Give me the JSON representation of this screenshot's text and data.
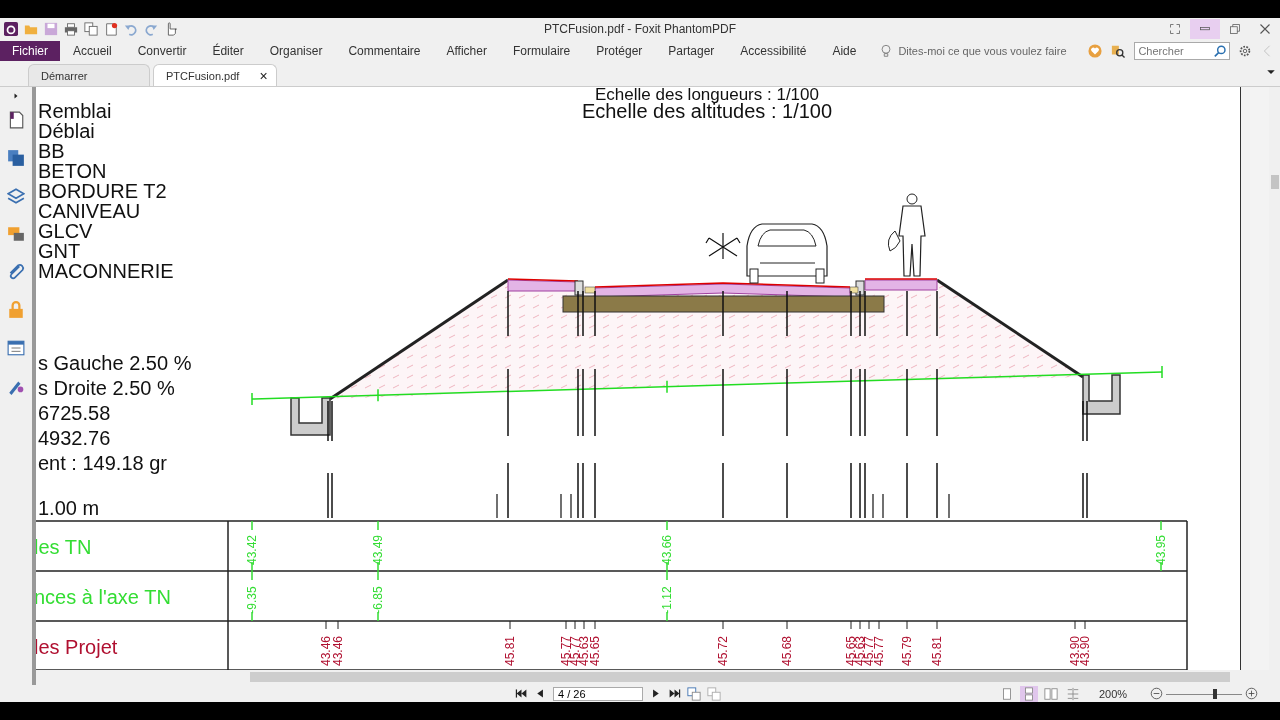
{
  "window": {
    "title": "PTCFusion.pdf - Foxit PhantomPDF"
  },
  "ribbon": [
    {
      "label": "Fichier",
      "kind": "file"
    },
    {
      "label": "Accueil",
      "kind": "tab"
    },
    {
      "label": "Convertir",
      "kind": "tab"
    },
    {
      "label": "Éditer",
      "kind": "tab"
    },
    {
      "label": "Organiser",
      "kind": "tab"
    },
    {
      "label": "Commentaire",
      "kind": "tab"
    },
    {
      "label": "Afficher",
      "kind": "tab"
    },
    {
      "label": "Formulaire",
      "kind": "tab"
    },
    {
      "label": "Protéger",
      "kind": "tab"
    },
    {
      "label": "Partager",
      "kind": "tab"
    },
    {
      "label": "Accessibilité",
      "kind": "tab"
    },
    {
      "label": "Aide",
      "kind": "tab"
    }
  ],
  "tell_me": {
    "placeholder": "Dites-moi ce que vous voulez faire"
  },
  "search": {
    "placeholder": "Chercher"
  },
  "doc_tabs": [
    {
      "label": "Démarrer",
      "selected": false
    },
    {
      "label": "PTCFusion.pdf",
      "selected": true,
      "close": "×"
    }
  ],
  "page": {
    "titles": [
      "Echelle des longueurs : 1/100",
      "Echelle des altitudes : 1/100"
    ],
    "legend": [
      "Remblai",
      "Déblai",
      "BB",
      "BETON",
      "BORDURE T2",
      "CANIVEAU",
      "GLCV",
      "GNT",
      "MACONNERIE"
    ],
    "parameters": [
      "s Gauche 2.50 %",
      "s Droite 2.50 %",
      "6725.58",
      "4932.76",
      "ent : 149.18 gr"
    ],
    "datum": "1.00 m",
    "table": [
      {
        "label": "les TN",
        "color": "#33dd33",
        "values": [
          "43.42",
          "43.49",
          "43.66",
          "43.95"
        ]
      },
      {
        "label": "nces à l'axe TN",
        "color": "#33dd33",
        "values": [
          "-9.35",
          "-6.85",
          "-1.12"
        ]
      },
      {
        "label": "les Projet",
        "color": "#b01030",
        "values": [
          "43.46",
          "43.46",
          "45.81",
          "45.77",
          "45.77",
          "45.63",
          "45.65",
          "45.72",
          "45.68",
          "45.65",
          "45.63",
          "45.77",
          "45.77",
          "45.79",
          "45.81",
          "43.90",
          "43.90"
        ]
      }
    ]
  },
  "status_bar": {
    "page": "4 / 26",
    "zoom": "200%",
    "zoom_slider": {
      "level": 0.65
    },
    "layouts": [
      {
        "selected": false
      },
      {
        "selected": true
      },
      {
        "selected": false
      },
      {
        "selected": false
      }
    ]
  }
}
